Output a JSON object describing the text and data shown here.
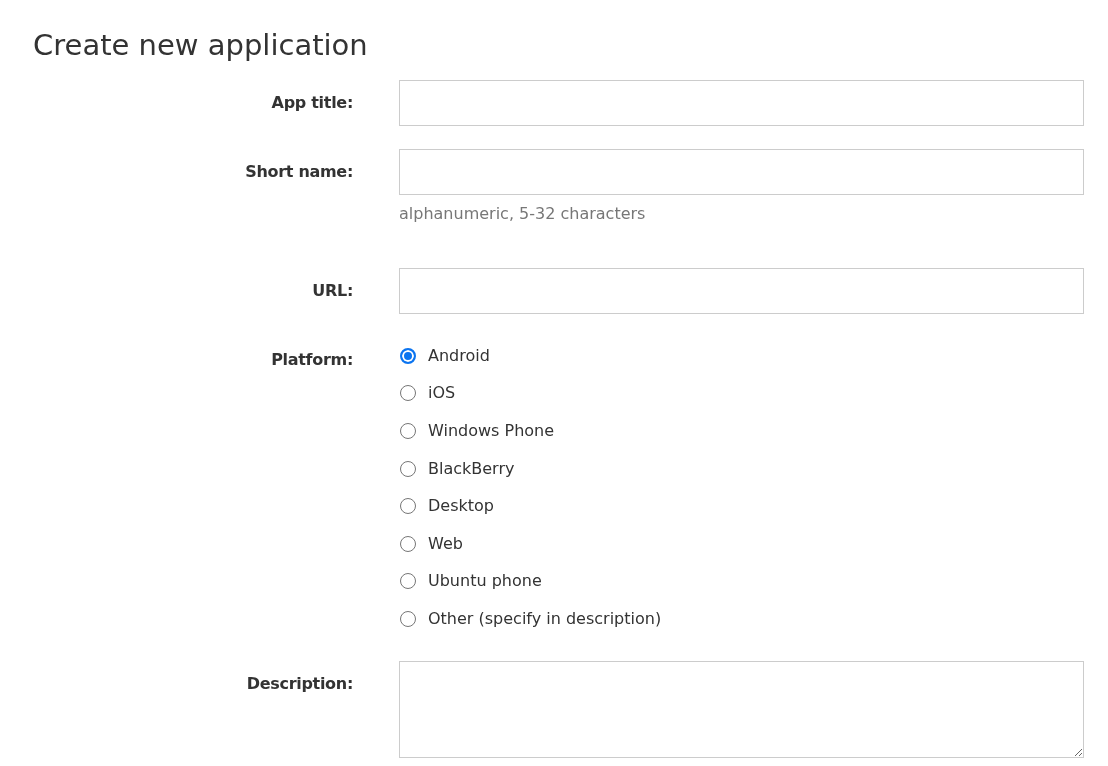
{
  "title": "Create new application",
  "fields": [
    {
      "kind": "text",
      "label": "App title:"
    },
    {
      "kind": "text",
      "label": "Short name:",
      "hint": "alphanumeric, 5-32 characters"
    },
    {
      "kind": "text",
      "label": "URL:"
    },
    {
      "kind": "radio",
      "label": "Platform:",
      "options": [
        {
          "label": "Android",
          "selected": true
        },
        {
          "label": "iOS",
          "selected": false
        },
        {
          "label": "Windows Phone",
          "selected": false
        },
        {
          "label": "BlackBerry",
          "selected": false
        },
        {
          "label": "Desktop",
          "selected": false
        },
        {
          "label": "Web",
          "selected": false
        },
        {
          "label": "Ubuntu phone",
          "selected": false
        },
        {
          "label": "Other (specify in description)",
          "selected": false
        }
      ]
    },
    {
      "kind": "textarea",
      "label": "Description:"
    }
  ]
}
